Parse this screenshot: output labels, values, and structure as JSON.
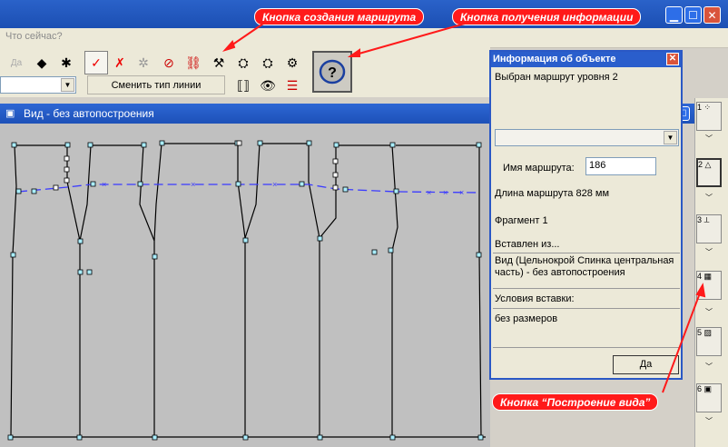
{
  "menu": {
    "whats_this": "Что сейчас?"
  },
  "toolbar": {
    "change_line_type": "Сменить тип линии",
    "info_glyph": "?",
    "da_btn": "Да"
  },
  "view": {
    "title": "Вид - без автопостроения"
  },
  "dialog": {
    "title": "Информация об объекте",
    "selected_route": "Выбран маршрут уровня  2",
    "route_name_label": "Имя маршрута:",
    "route_name_value": "186",
    "route_length": "Длина маршрута 828 мм",
    "fragment": "Фрагмент 1",
    "inserted_from_label": "Вставлен из...",
    "inserted_from_value": "Вид (Цельнокрой Спинка центральная часть) - без автопостроения",
    "insert_conditions_label": "Условия вставки:",
    "insert_conditions_value": "без размеров",
    "ok_button": "Да"
  },
  "right_panel": {
    "labels": [
      "1",
      "2",
      "3",
      "4",
      "5",
      "6"
    ]
  },
  "callouts": {
    "create_route": "Кнопка создания маршрута",
    "get_info": "Кнопка получения информации",
    "build_view": "Кнопка “Построение вида”"
  },
  "colors": {
    "callout": "#ff1a1a",
    "title_bar": "#2a5ecc",
    "canvas": "#c0c0c0",
    "route": "#3b3bff"
  }
}
